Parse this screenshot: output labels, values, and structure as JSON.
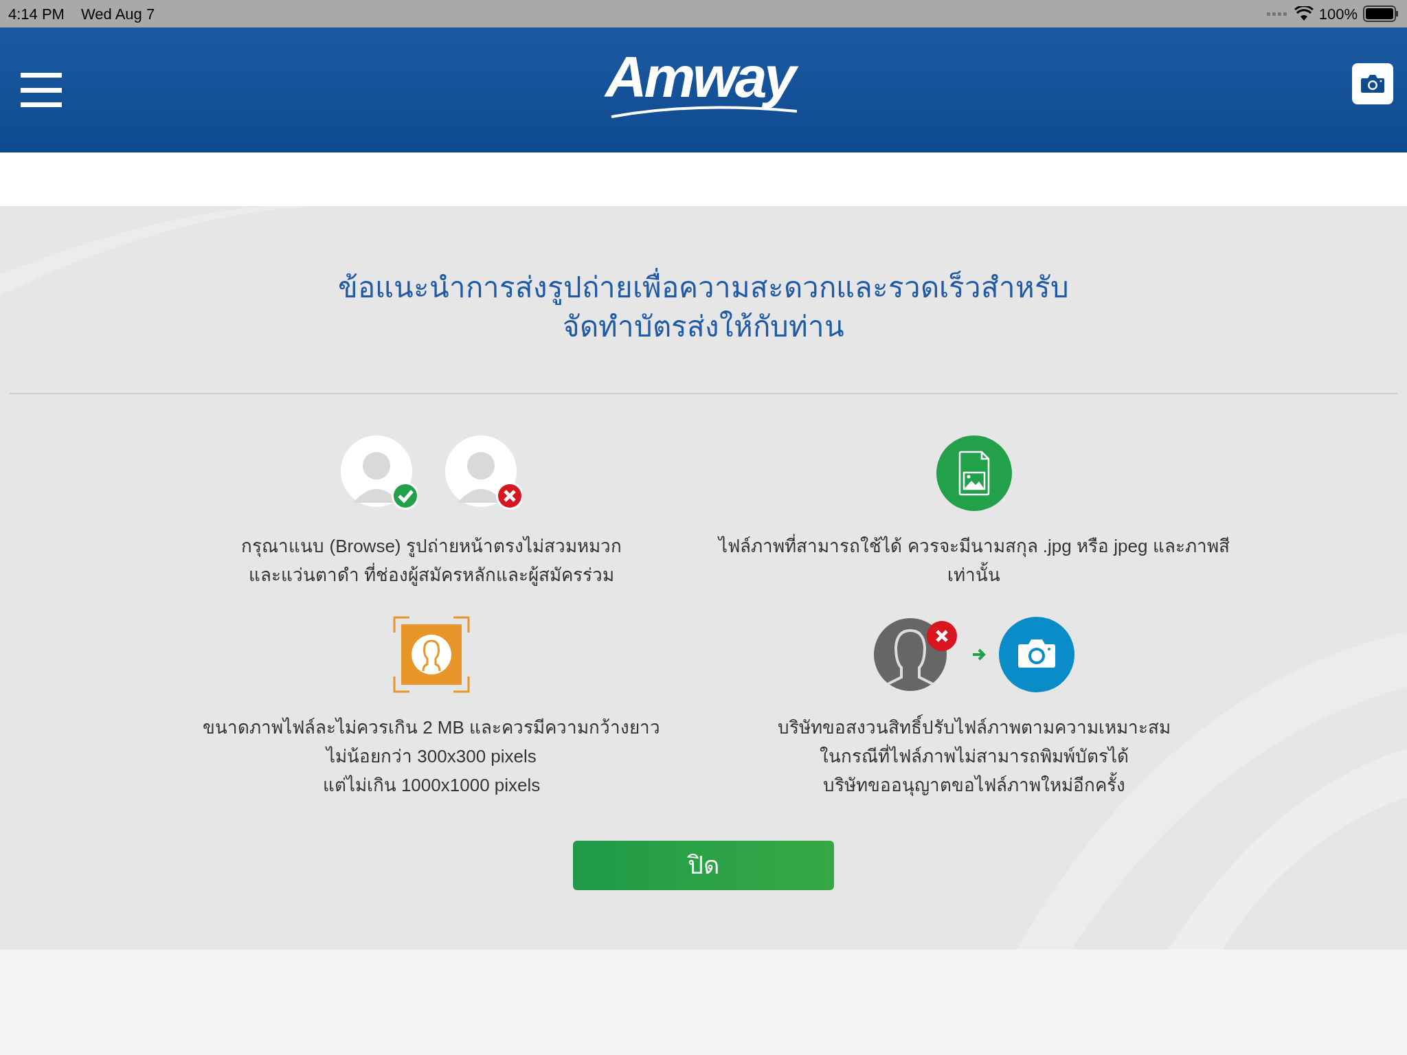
{
  "status_bar": {
    "time": "4:14 PM",
    "date": "Wed Aug 7",
    "battery": "100%"
  },
  "header": {
    "logo": "Amway"
  },
  "title": "ข้อแนะนำการส่งรูปถ่ายเพื่อความสะดวกและรวดเร็วสำหรับ\nจัดทำบัตรส่งให้กับท่าน",
  "tips": [
    {
      "kind": "faces",
      "text": "กรุณาแนบ (Browse) รูปถ่ายหน้าตรงไม่สวมหมวก\nและแว่นตาดำ ที่ช่องผู้สมัครหลักและผู้สมัครร่วม"
    },
    {
      "kind": "file",
      "text": "ไฟล์ภาพที่สามารถใช้ได้ ควรจะมีนามสกุล .jpg หรือ jpeg และภาพสี\nเท่านั้น"
    },
    {
      "kind": "size",
      "text": "ขนาดภาพไฟล์ละไม่ควรเกิน 2 MB และควรมีความกว้างยาว\nไม่น้อยกว่า 300x300 pixels\nแต่ไม่เกิน 1000x1000 pixels"
    },
    {
      "kind": "replace",
      "text": "บริษัทขอสงวนสิทธิ์ปรับไฟล์ภาพตามความเหมาะสม\nในกรณีที่ไฟล์ภาพไม่สามารถพิมพ์บัตรได้\nบริษัทขออนุญาตขอไฟล์ภาพใหม่อีกครั้ง"
    }
  ],
  "close_button": "ปิด"
}
